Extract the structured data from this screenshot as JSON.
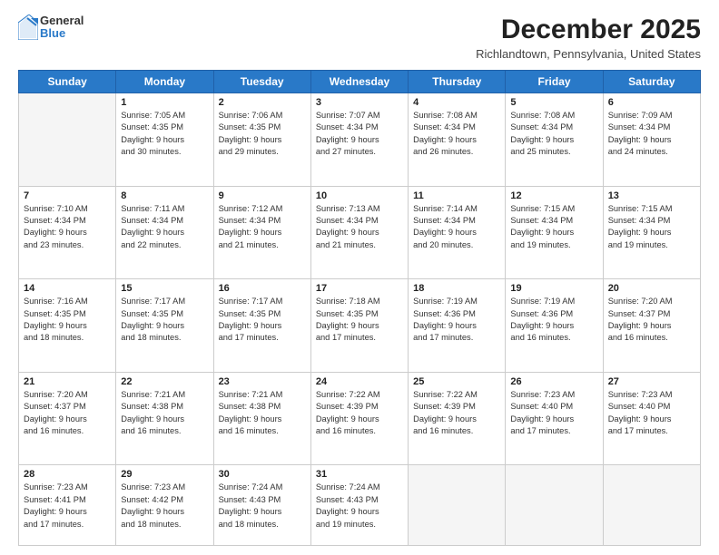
{
  "header": {
    "logo_general": "General",
    "logo_blue": "Blue",
    "title": "December 2025",
    "subtitle": "Richlandtown, Pennsylvania, United States"
  },
  "columns": [
    "Sunday",
    "Monday",
    "Tuesday",
    "Wednesday",
    "Thursday",
    "Friday",
    "Saturday"
  ],
  "weeks": [
    [
      {
        "day": "",
        "info": ""
      },
      {
        "day": "1",
        "info": "Sunrise: 7:05 AM\nSunset: 4:35 PM\nDaylight: 9 hours\nand 30 minutes."
      },
      {
        "day": "2",
        "info": "Sunrise: 7:06 AM\nSunset: 4:35 PM\nDaylight: 9 hours\nand 29 minutes."
      },
      {
        "day": "3",
        "info": "Sunrise: 7:07 AM\nSunset: 4:34 PM\nDaylight: 9 hours\nand 27 minutes."
      },
      {
        "day": "4",
        "info": "Sunrise: 7:08 AM\nSunset: 4:34 PM\nDaylight: 9 hours\nand 26 minutes."
      },
      {
        "day": "5",
        "info": "Sunrise: 7:08 AM\nSunset: 4:34 PM\nDaylight: 9 hours\nand 25 minutes."
      },
      {
        "day": "6",
        "info": "Sunrise: 7:09 AM\nSunset: 4:34 PM\nDaylight: 9 hours\nand 24 minutes."
      }
    ],
    [
      {
        "day": "7",
        "info": "Sunrise: 7:10 AM\nSunset: 4:34 PM\nDaylight: 9 hours\nand 23 minutes."
      },
      {
        "day": "8",
        "info": "Sunrise: 7:11 AM\nSunset: 4:34 PM\nDaylight: 9 hours\nand 22 minutes."
      },
      {
        "day": "9",
        "info": "Sunrise: 7:12 AM\nSunset: 4:34 PM\nDaylight: 9 hours\nand 21 minutes."
      },
      {
        "day": "10",
        "info": "Sunrise: 7:13 AM\nSunset: 4:34 PM\nDaylight: 9 hours\nand 21 minutes."
      },
      {
        "day": "11",
        "info": "Sunrise: 7:14 AM\nSunset: 4:34 PM\nDaylight: 9 hours\nand 20 minutes."
      },
      {
        "day": "12",
        "info": "Sunrise: 7:15 AM\nSunset: 4:34 PM\nDaylight: 9 hours\nand 19 minutes."
      },
      {
        "day": "13",
        "info": "Sunrise: 7:15 AM\nSunset: 4:34 PM\nDaylight: 9 hours\nand 19 minutes."
      }
    ],
    [
      {
        "day": "14",
        "info": "Sunrise: 7:16 AM\nSunset: 4:35 PM\nDaylight: 9 hours\nand 18 minutes."
      },
      {
        "day": "15",
        "info": "Sunrise: 7:17 AM\nSunset: 4:35 PM\nDaylight: 9 hours\nand 18 minutes."
      },
      {
        "day": "16",
        "info": "Sunrise: 7:17 AM\nSunset: 4:35 PM\nDaylight: 9 hours\nand 17 minutes."
      },
      {
        "day": "17",
        "info": "Sunrise: 7:18 AM\nSunset: 4:35 PM\nDaylight: 9 hours\nand 17 minutes."
      },
      {
        "day": "18",
        "info": "Sunrise: 7:19 AM\nSunset: 4:36 PM\nDaylight: 9 hours\nand 17 minutes."
      },
      {
        "day": "19",
        "info": "Sunrise: 7:19 AM\nSunset: 4:36 PM\nDaylight: 9 hours\nand 16 minutes."
      },
      {
        "day": "20",
        "info": "Sunrise: 7:20 AM\nSunset: 4:37 PM\nDaylight: 9 hours\nand 16 minutes."
      }
    ],
    [
      {
        "day": "21",
        "info": "Sunrise: 7:20 AM\nSunset: 4:37 PM\nDaylight: 9 hours\nand 16 minutes."
      },
      {
        "day": "22",
        "info": "Sunrise: 7:21 AM\nSunset: 4:38 PM\nDaylight: 9 hours\nand 16 minutes."
      },
      {
        "day": "23",
        "info": "Sunrise: 7:21 AM\nSunset: 4:38 PM\nDaylight: 9 hours\nand 16 minutes."
      },
      {
        "day": "24",
        "info": "Sunrise: 7:22 AM\nSunset: 4:39 PM\nDaylight: 9 hours\nand 16 minutes."
      },
      {
        "day": "25",
        "info": "Sunrise: 7:22 AM\nSunset: 4:39 PM\nDaylight: 9 hours\nand 16 minutes."
      },
      {
        "day": "26",
        "info": "Sunrise: 7:23 AM\nSunset: 4:40 PM\nDaylight: 9 hours\nand 17 minutes."
      },
      {
        "day": "27",
        "info": "Sunrise: 7:23 AM\nSunset: 4:40 PM\nDaylight: 9 hours\nand 17 minutes."
      }
    ],
    [
      {
        "day": "28",
        "info": "Sunrise: 7:23 AM\nSunset: 4:41 PM\nDaylight: 9 hours\nand 17 minutes."
      },
      {
        "day": "29",
        "info": "Sunrise: 7:23 AM\nSunset: 4:42 PM\nDaylight: 9 hours\nand 18 minutes."
      },
      {
        "day": "30",
        "info": "Sunrise: 7:24 AM\nSunset: 4:43 PM\nDaylight: 9 hours\nand 18 minutes."
      },
      {
        "day": "31",
        "info": "Sunrise: 7:24 AM\nSunset: 4:43 PM\nDaylight: 9 hours\nand 19 minutes."
      },
      {
        "day": "",
        "info": ""
      },
      {
        "day": "",
        "info": ""
      },
      {
        "day": "",
        "info": ""
      }
    ]
  ]
}
